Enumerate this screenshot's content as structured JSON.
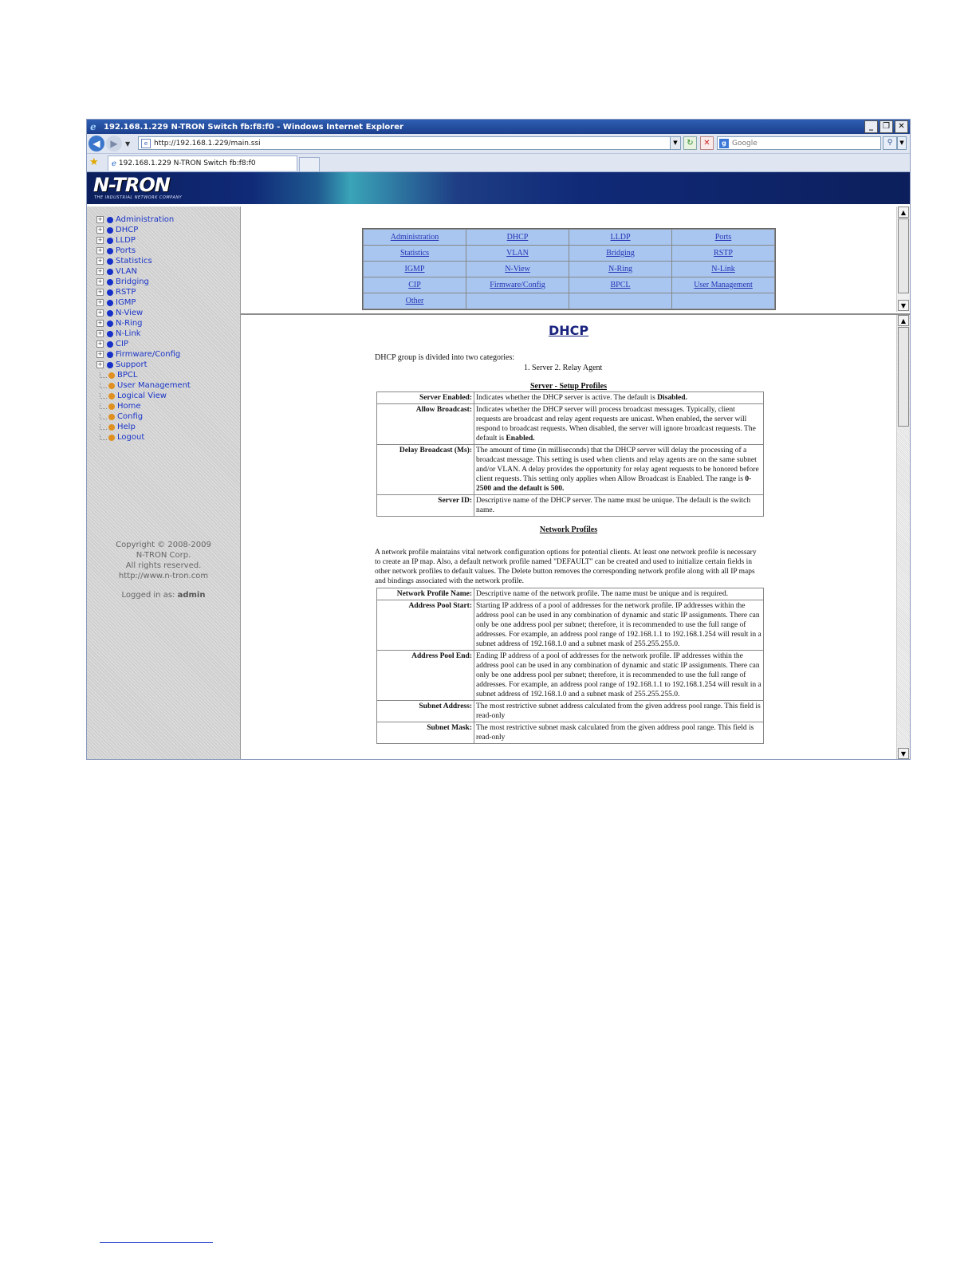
{
  "window": {
    "title": "192.168.1.229 N-TRON Switch fb:f8:f0 - Windows Internet Explorer",
    "controls": [
      "_",
      "❐",
      "✕"
    ]
  },
  "address": {
    "url": "http://192.168.1.229/main.ssi",
    "search_placeholder": "Google"
  },
  "tab": {
    "label": "192.168.1.229 N-TRON Switch fb:f8:f0"
  },
  "logo": {
    "text": "N-TRON",
    "tagline": "THE INDUSTRIAL NETWORK COMPANY"
  },
  "sidebar": {
    "items": [
      {
        "label": "Administration",
        "type": "folder"
      },
      {
        "label": "DHCP",
        "type": "folder"
      },
      {
        "label": "LLDP",
        "type": "folder"
      },
      {
        "label": "Ports",
        "type": "folder"
      },
      {
        "label": "Statistics",
        "type": "folder"
      },
      {
        "label": "VLAN",
        "type": "folder"
      },
      {
        "label": "Bridging",
        "type": "folder"
      },
      {
        "label": "RSTP",
        "type": "folder"
      },
      {
        "label": "IGMP",
        "type": "folder"
      },
      {
        "label": "N-View",
        "type": "folder"
      },
      {
        "label": "N-Ring",
        "type": "folder"
      },
      {
        "label": "N-Link",
        "type": "folder"
      },
      {
        "label": "CIP",
        "type": "folder"
      },
      {
        "label": "Firmware/Config",
        "type": "folder"
      },
      {
        "label": "Support",
        "type": "folder"
      },
      {
        "label": "BPCL",
        "type": "leaf"
      },
      {
        "label": "User Management",
        "type": "leaf"
      },
      {
        "label": "Logical View",
        "type": "leaf"
      },
      {
        "label": "Home",
        "type": "leaf"
      },
      {
        "label": "Config",
        "type": "leaf"
      },
      {
        "label": "Help",
        "type": "leaf"
      },
      {
        "label": "Logout",
        "type": "leaf"
      }
    ],
    "copyright": [
      "Copyright © 2008-2009",
      "N-TRON Corp.",
      "All rights reserved.",
      "http://www.n-tron.com"
    ],
    "logged_in_label": "Logged in as:",
    "logged_in_user": "admin"
  },
  "nav_links": [
    [
      "Administration",
      "DHCP",
      "LLDP",
      "Ports"
    ],
    [
      "Statistics",
      "VLAN",
      "Bridging",
      "RSTP"
    ],
    [
      "IGMP",
      "N-View",
      "N-Ring",
      "N-Link"
    ],
    [
      "CIP",
      "Firmware/Config",
      "BPCL",
      "User Management"
    ],
    [
      "Other",
      "",
      "",
      ""
    ]
  ],
  "main": {
    "title": "DHCP",
    "intro": "DHCP group is divided into two categories:",
    "categories": "1. Server    2. Relay Agent",
    "server_section_title": "Server - Setup Profiles",
    "server_rows": [
      {
        "key": "Server Enabled:",
        "value": "Indicates whether the DHCP server is active. The default is ",
        "bold": "Disabled."
      },
      {
        "key": "Allow Broadcast:",
        "value": "Indicates whether the DHCP server will process broadcast messages. Typically, client requests are broadcast and relay agent requests are unicast. When enabled, the server will respond to broadcast requests. When disabled, the server will ignore broadcast requests. The default is ",
        "bold": "Enabled."
      },
      {
        "key": "Delay Broadcast (Ms):",
        "value": "The amount of time (in milliseconds) that the DHCP server will delay the processing of a broadcast message. This setting is used when clients and relay agents are on the same subnet and/or VLAN. A delay provides the opportunity for relay agent requests to be honored before client requests. This setting only applies when Allow Broadcast is Enabled. The range is ",
        "bold": "0-2500 and the default is 500."
      },
      {
        "key": "Server ID:",
        "value": "Descriptive name of the DHCP server. The name must be unique. The default is the switch name.",
        "bold": ""
      }
    ],
    "network_section_title": "Network Profiles",
    "network_paragraph": "A network profile maintains vital network configuration options for potential clients. At least one network profile is necessary to create an IP map. Also, a default network profile named \"DEFAULT\" can be created and used to initialize certain fields in other network profiles to default values. The Delete button removes the corresponding network profile along with all IP maps and bindings associated with the network profile.",
    "network_rows": [
      {
        "key": "Network Profile Name:",
        "value": "Descriptive name of the network profile. The name must be unique and is required."
      },
      {
        "key": "Address Pool Start:",
        "value": "Starting IP address of a pool of addresses for the network profile. IP addresses within the address pool can be used in any combination of dynamic and static IP assignments. There can only be one address pool per subnet; therefore, it is recommended to use the full range of addresses. For example, an address pool range of 192.168.1.1 to 192.168.1.254 will result in a subnet address of 192.168.1.0 and a subnet mask of 255.255.255.0."
      },
      {
        "key": "Address Pool End:",
        "value": "Ending IP address of a pool of addresses for the network profile. IP addresses within the address pool can be used in any combination of dynamic and static IP assignments. There can only be one address pool per subnet; therefore, it is recommended to use the full range of addresses. For example, an address pool range of 192.168.1.1 to 192.168.1.254 will result in a subnet address of 192.168.1.0 and a subnet mask of 255.255.255.0."
      },
      {
        "key": "Subnet Address:",
        "value": "The most restrictive subnet address calculated from the given address pool range. This field is read-only"
      },
      {
        "key": "Subnet Mask:",
        "value": "The most restrictive subnet mask calculated from the given address pool range. This field is read-only"
      }
    ]
  }
}
